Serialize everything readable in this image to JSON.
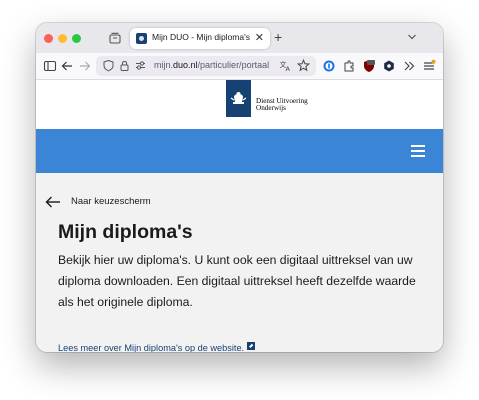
{
  "browser": {
    "tab": {
      "title": "Mijn DUO - Mijn diploma's"
    },
    "url": {
      "prefix": "mijn.",
      "domain": "duo.nl",
      "path": "/particulier/portaal"
    }
  },
  "site": {
    "logo": {
      "line1": "Dienst Uitvoering",
      "line2": "Onderwijs"
    },
    "accent_color": "#3a85d6",
    "brand_color": "#154273"
  },
  "page": {
    "back_label": "Naar keuzescherm",
    "title": "Mijn diploma's",
    "intro": "Bekijk hier uw diploma's. U kunt ook een digitaal uittreksel van uw diploma downloaden. Een digitaal uittreksel heeft dezelfde waarde als het originele diploma.",
    "more_link": "Lees meer over Mijn diploma's op de website."
  }
}
